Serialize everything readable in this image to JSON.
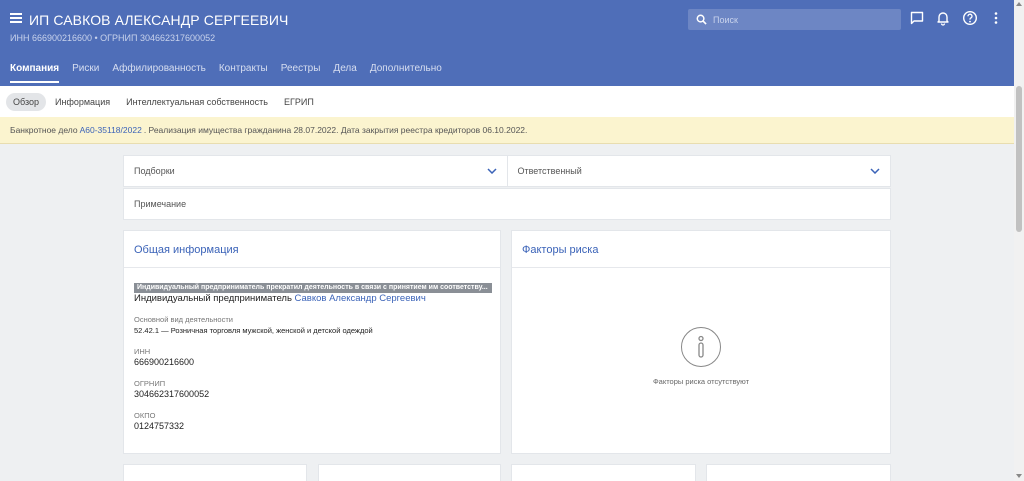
{
  "header": {
    "title": "ИП САВКОВ АЛЕКСАНДР СЕРГЕЕВИЧ",
    "subtitle": "ИНН 666900216600  •  ОГРНИП 304662317600052",
    "search_placeholder": "Поиск"
  },
  "tabs": [
    {
      "label": "Компания"
    },
    {
      "label": "Риски"
    },
    {
      "label": "Аффилированность"
    },
    {
      "label": "Контракты"
    },
    {
      "label": "Реестры"
    },
    {
      "label": "Дела"
    },
    {
      "label": "Дополнительно"
    }
  ],
  "subtabs": [
    {
      "label": "Обзор"
    },
    {
      "label": "Информация"
    },
    {
      "label": "Интеллектуальная собственность"
    },
    {
      "label": "ЕГРИП"
    }
  ],
  "banner": {
    "prefix": "Банкротное дело",
    "case_link": "А60-35118/2022",
    "suffix": ". Реализация имущества гражданина 28.07.2022. Дата закрытия реестра кредиторов 06.10.2022."
  },
  "selectors": {
    "collections": "Подборки",
    "responsible": "Ответственный",
    "note": "Примечание"
  },
  "general_info": {
    "title": "Общая информация",
    "status": "Индивидуальный предприниматель прекратил деятельность в связи с принятием им соответству...",
    "ip_prefix": "Индивидуальный предприниматель",
    "ip_name": "Савков Александр Сергеевич",
    "activity_label": "Основной вид деятельности",
    "activity_value": "52.42.1 — Розничная торговля мужской, женской и детской одеждой",
    "inn_label": "ИНН",
    "inn_value": "666900216600",
    "ogrnip_label": "ОГРНИП",
    "ogrnip_value": "304662317600052",
    "okpo_label": "ОКПО",
    "okpo_value": "0124757332"
  },
  "risk_factors": {
    "title": "Факторы риска",
    "empty_text": "Факторы риска отсутствуют"
  },
  "colors": {
    "header_bg": "#4f6eb8",
    "link": "#3b63b8",
    "banner_bg": "#fbf4cf"
  }
}
